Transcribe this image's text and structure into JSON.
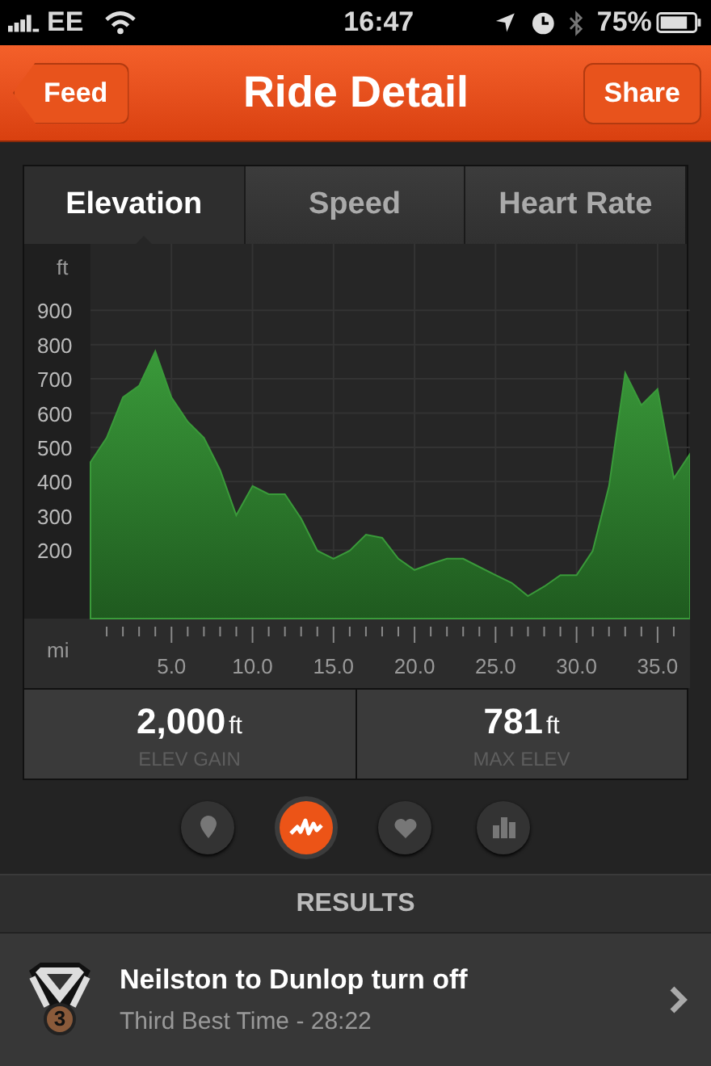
{
  "status_bar": {
    "carrier": "EE",
    "time": "16:47",
    "battery": "75%"
  },
  "nav": {
    "back": "Feed",
    "title": "Ride Detail",
    "action": "Share"
  },
  "tabs": [
    {
      "label": "Elevation",
      "selected": true
    },
    {
      "label": "Speed",
      "selected": false
    },
    {
      "label": "Heart Rate",
      "selected": false
    }
  ],
  "chart_data": {
    "type": "area",
    "xlabel": "mi",
    "ylabel": "ft",
    "x": [
      0,
      1,
      2,
      3,
      4,
      5,
      6,
      7,
      8,
      9,
      10,
      11,
      12,
      13,
      14,
      15,
      16,
      17,
      18,
      19,
      20,
      21,
      22,
      23,
      24,
      25,
      26,
      27,
      28,
      29,
      30,
      31,
      32,
      33,
      34,
      35,
      36,
      37
    ],
    "series": [
      {
        "color": "#3a9a3a",
        "values": [
          457,
          528,
          646,
          680,
          781,
          646,
          575,
          528,
          434,
          302,
          387,
          363,
          363,
          292,
          198,
          175,
          198,
          245,
          236,
          175,
          142,
          160,
          175,
          175,
          151,
          127,
          104,
          66,
          94,
          127,
          127,
          198,
          387,
          717,
          623,
          670,
          410,
          481
        ]
      }
    ],
    "xlim": [
      0,
      37
    ],
    "ylim": [
      0,
      1094
    ],
    "grid": true,
    "xticks": [
      {
        "value": 5,
        "label": "5.0"
      },
      {
        "value": 10,
        "label": "10.0"
      },
      {
        "value": 15,
        "label": "15.0"
      },
      {
        "value": 20,
        "label": "20.0"
      },
      {
        "value": 25,
        "label": "25.0"
      },
      {
        "value": 30,
        "label": "30.0"
      },
      {
        "value": 35,
        "label": "35.0"
      }
    ],
    "yticks": [
      200,
      300,
      400,
      500,
      600,
      700,
      800,
      900
    ]
  },
  "stats": [
    {
      "value": "2,000",
      "unit": "ft",
      "label": "ELEV GAIN"
    },
    {
      "value": "781",
      "unit": "ft",
      "label": "MAX ELEV"
    }
  ],
  "pager": [
    {
      "kind": "pin",
      "selected": false
    },
    {
      "kind": "wave",
      "selected": true
    },
    {
      "kind": "heart",
      "selected": false
    },
    {
      "kind": "bars",
      "selected": false
    }
  ],
  "results": {
    "title": "RESULTS",
    "items": [
      {
        "name": "Neilston to Dunlop turn off",
        "detail": "Third Best Time - 28:22",
        "medal": "3"
      }
    ]
  }
}
